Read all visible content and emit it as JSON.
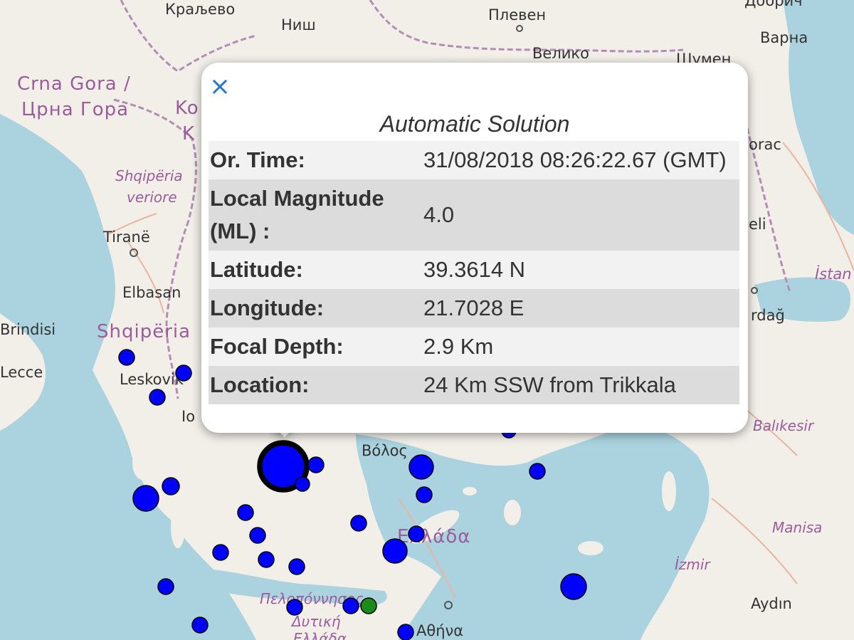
{
  "map": {
    "colors": {
      "land": "#f2efe9",
      "sea": "#aad3df",
      "border": "#b38db3",
      "road": "#e8b5a0"
    },
    "city_labels": [
      "Краљево",
      "Ниш",
      "Плевен",
      "Добрич",
      "Варна",
      "Велико",
      "Шумен",
      "Tiranë",
      "Elbasan",
      "Leskovik",
      "Brindisi",
      "Lecce",
      "Βόλος",
      "Αθήνα",
      "Aydın",
      "İstan",
      "rdağ",
      "eli",
      "orac",
      "Io"
    ],
    "country_labels": [
      "Crna Gora /",
      "Црна Гора",
      "Shqipëria",
      "Ελλάδα",
      "Ko",
      "K"
    ],
    "region_labels": [
      "Shqipëria",
      "veriore",
      "Balıkesir",
      "Manisa",
      "İzmir",
      "Πελοπόννησος",
      "Δυτική",
      "Ελλάδα"
    ],
    "markers": {
      "colors": {
        "event": "#0000ff",
        "selected": "#0000ff",
        "other": "#1a8c1a"
      },
      "selected_count": 1,
      "event_count": 26,
      "other_count": 1
    }
  },
  "popup": {
    "close_label": "×",
    "title": "Automatic Solution",
    "rows": [
      {
        "key": "Or. Time:",
        "value": "31/08/2018 08:26:22.67 (GMT)"
      },
      {
        "key": "Local Magnitude (ML) :",
        "value": "4.0"
      },
      {
        "key": "Latitude:",
        "value": "39.3614 N"
      },
      {
        "key": "Longitude:",
        "value": "21.7028 E"
      },
      {
        "key": "Focal Depth:",
        "value": "2.9 Km"
      },
      {
        "key": "Location:",
        "value": "24 Km SSW from Trikkala"
      }
    ]
  }
}
